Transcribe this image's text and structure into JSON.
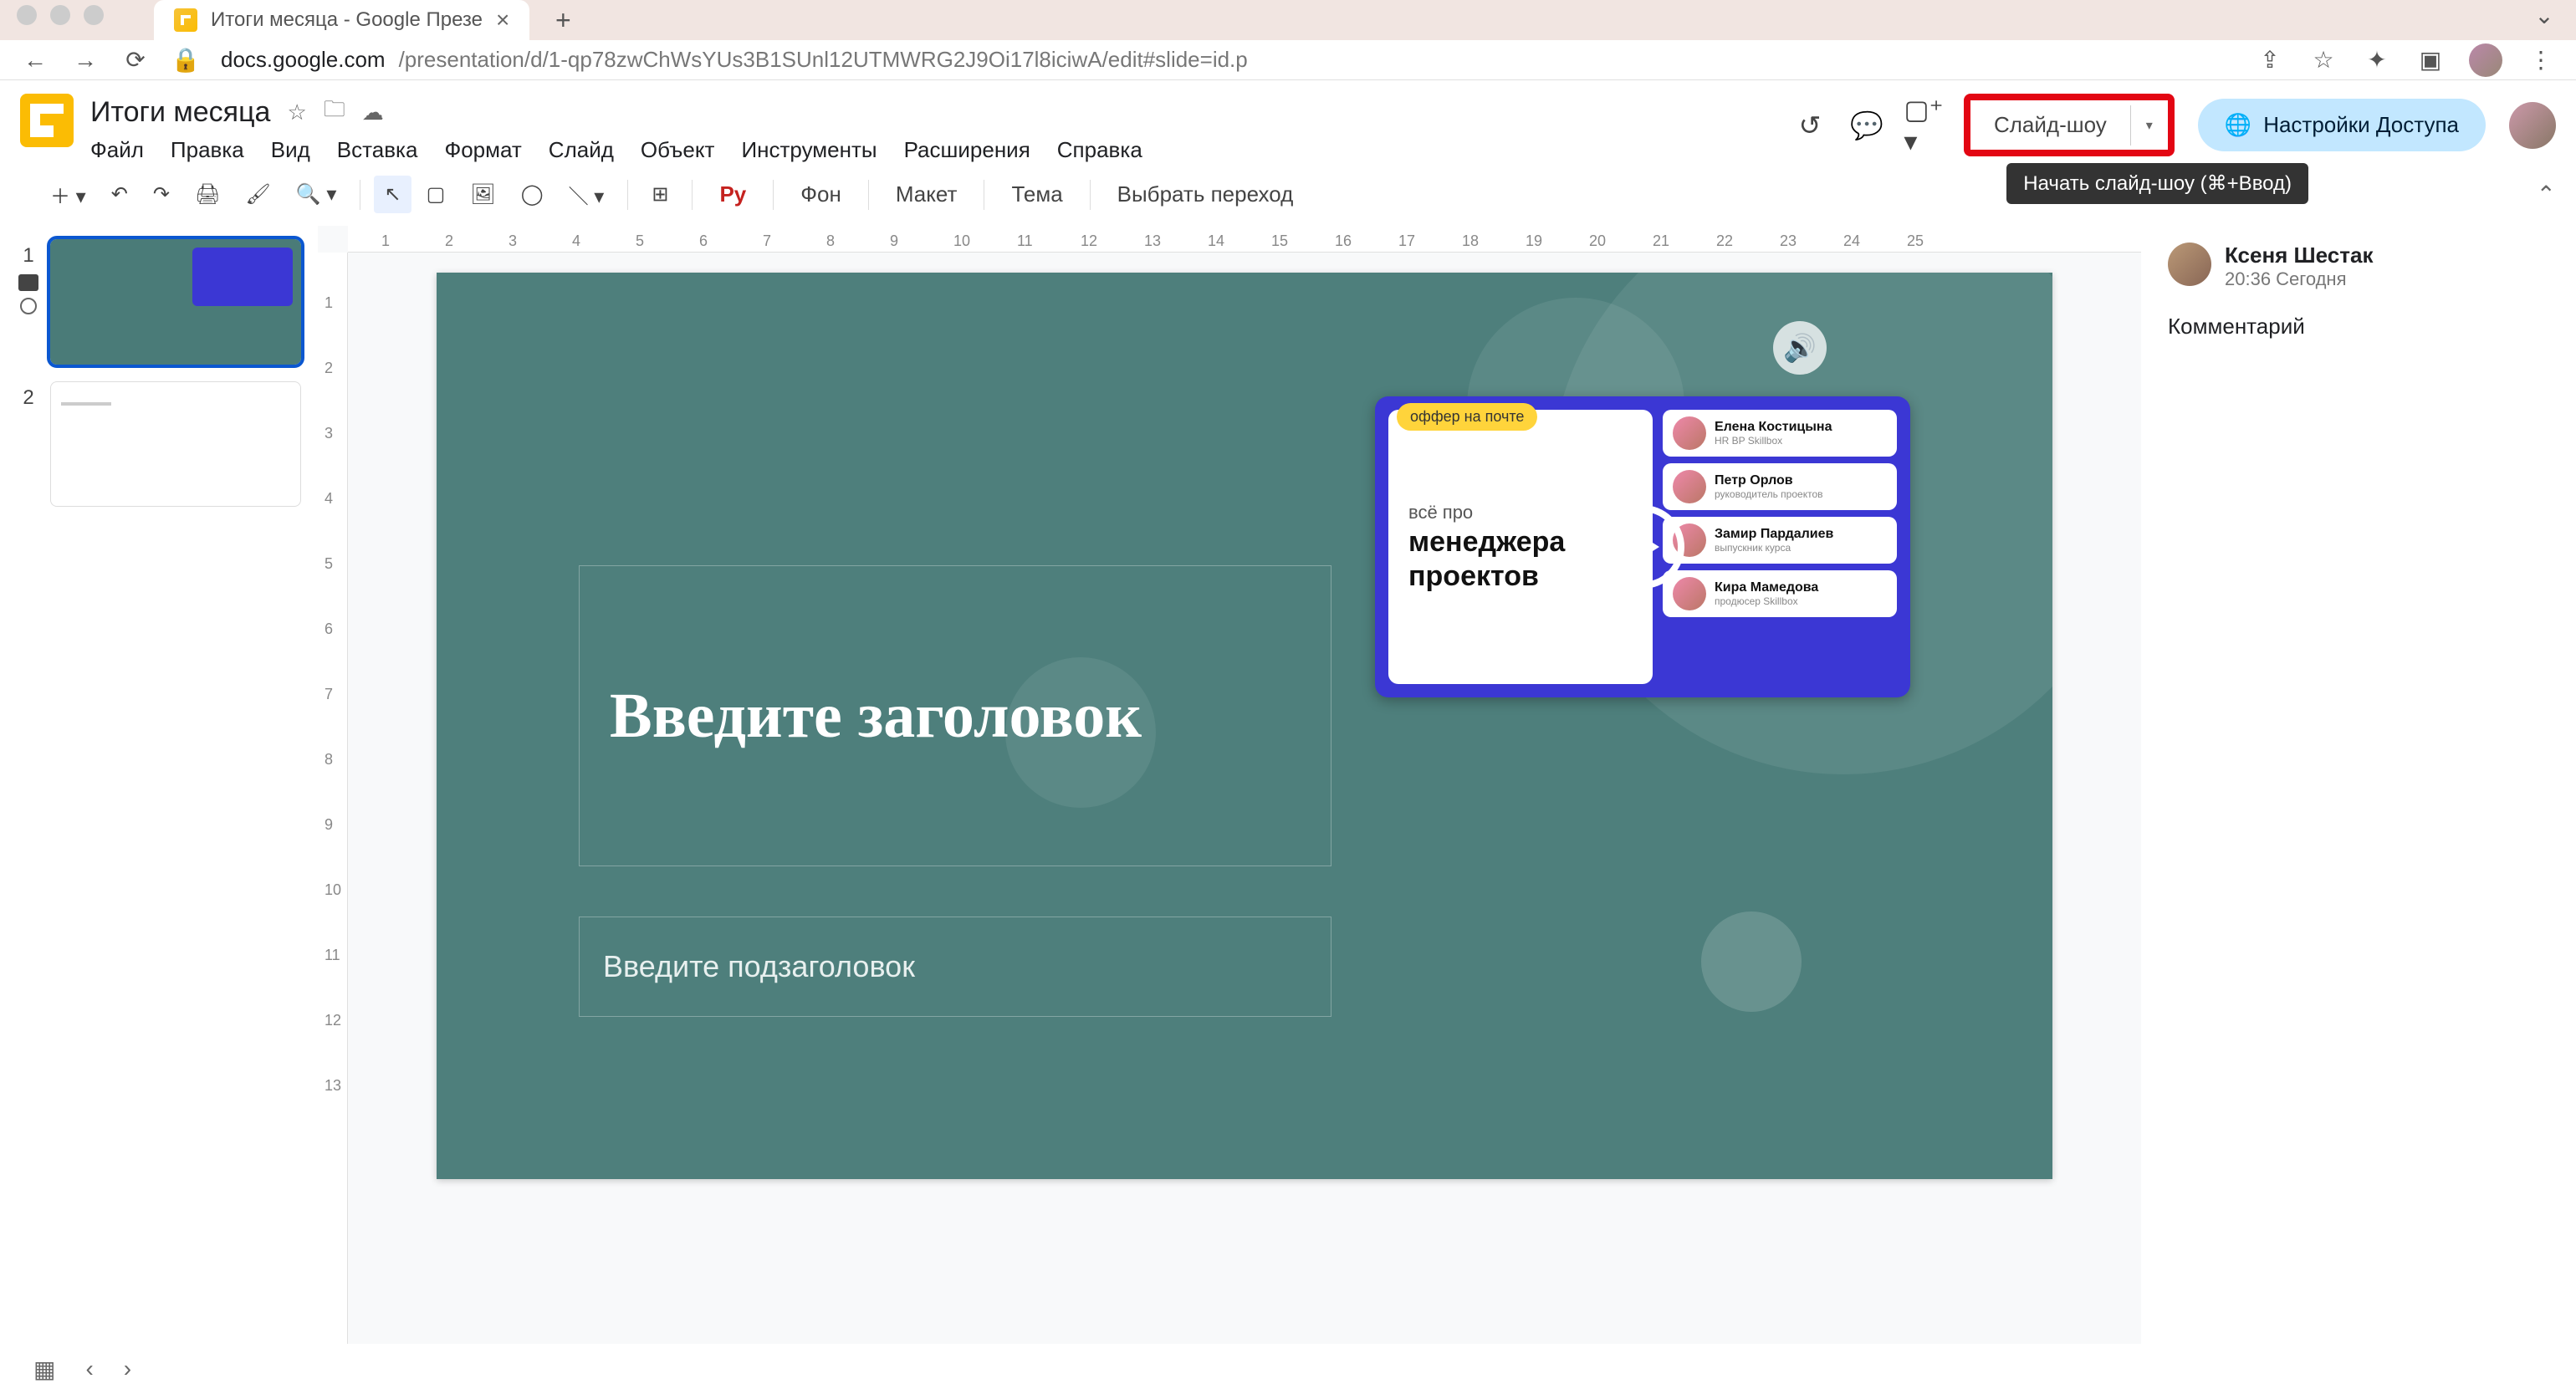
{
  "browser": {
    "tab_title": "Итоги месяца - Google Презе",
    "url_host": "docs.google.com",
    "url_path": "/presentation/d/1-qp78zwChWsYUs3B1SUnl12UTMWRG2J9Oi17l8iciwA/edit#slide=id.p"
  },
  "doc": {
    "title": "Итоги месяца",
    "menus": [
      "Файл",
      "Правка",
      "Вид",
      "Вставка",
      "Формат",
      "Слайд",
      "Объект",
      "Инструменты",
      "Расширения",
      "Справка"
    ],
    "slideshow_label": "Слайд-шоу",
    "share_label": "Настройки Доступа",
    "tooltip": "Начать слайд-шоу (⌘+Ввод)"
  },
  "toolbar": {
    "font_mark": "Рy",
    "bg": "Фон",
    "layout": "Макет",
    "theme": "Тема",
    "transition": "Выбрать переход"
  },
  "ruler_h": [
    "1",
    "2",
    "3",
    "4",
    "5",
    "6",
    "7",
    "8",
    "9",
    "10",
    "11",
    "12",
    "13",
    "14",
    "15",
    "16",
    "17",
    "18",
    "19",
    "20",
    "21",
    "22",
    "23",
    "24",
    "25"
  ],
  "ruler_v": [
    "1",
    "2",
    "3",
    "4",
    "5",
    "6",
    "7",
    "8",
    "9",
    "10",
    "11",
    "12",
    "13"
  ],
  "thumbs": {
    "n1": "1",
    "n2": "2"
  },
  "slide": {
    "title_placeholder": "Введите заголовок",
    "subtitle_placeholder": "Введите подзаголовок",
    "video": {
      "badge": "оффер на почте",
      "t1": "всё про",
      "t2a": "менеджера",
      "t2b": "проектов",
      "people": [
        {
          "name": "Елена Костицына",
          "role": "HR BP Skillbox"
        },
        {
          "name": "Петр Орлов",
          "role": "руководитель проектов"
        },
        {
          "name": "Замир Пардалиев",
          "role": "выпускник курса"
        },
        {
          "name": "Кира Мамедова",
          "role": "продюсер Skillbox"
        }
      ]
    }
  },
  "comments": {
    "author": "Ксеня Шестак",
    "time": "20:36 Сегодня",
    "body": "Комментарий"
  }
}
